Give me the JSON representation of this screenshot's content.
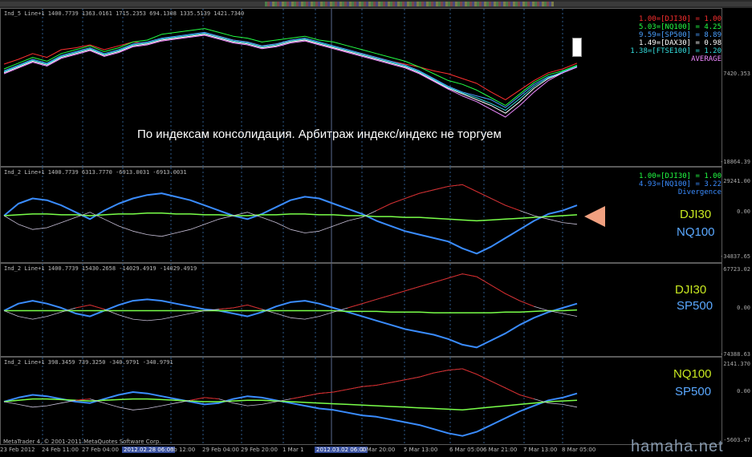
{
  "header_text": "",
  "annotation": "По индексам консолидация. Арбитраж индекс/индекс не торгуем",
  "copyright": "MetaTrader 4, © 2001-2011 MetaQuotes Software Corp.",
  "watermark": "hamaha.net",
  "colors": {
    "dji": "#ff3030",
    "nq": "#22ff44",
    "sp": "#4aa0ff",
    "dax": "#ffffff",
    "ftse": "#33dddd",
    "average": "#ee88ff",
    "divergence": "#3a8cff",
    "green_line": "#7aff4a",
    "white_line": "#c8c0d8",
    "red_line": "#dd2020",
    "pair_yellow": "#c8e820",
    "pair_blue": "#5aa8ff",
    "grid": "#2e5a8a"
  },
  "panels": [
    {
      "id": "main",
      "header": "Ind_5 Line+1 1400.7739 1363.0161 1715.2353 694.1308 1335.5139 1421.7340",
      "axis_top": "7420.353",
      "axis_bottom": "-18864.39",
      "legend": [
        {
          "text": "1.00=[DJI30] = 1.00",
          "color": "#ff3030"
        },
        {
          "text": "5.03=[NQ100] = 4.25",
          "color": "#22ff44"
        },
        {
          "text": "9.59=[SP500] = 8.89",
          "color": "#4aa0ff"
        },
        {
          "text": "1.49=[DAX30] = 0.98",
          "color": "#ffffff"
        },
        {
          "text": "1.38=[FTSE100] = 1.20",
          "color": "#33dddd"
        },
        {
          "text": "AVERAGE",
          "color": "#ee88ff"
        }
      ]
    },
    {
      "id": "div1",
      "header": "Ind_2 Line+1 1400.7739 6313.7770 -6913.0031 -6913.0031",
      "axis_top": "29241.00",
      "axis_mid": "0.00",
      "axis_bottom": "-34837.65",
      "legend": [
        {
          "text": "1.00=[DJI30] = 1.00",
          "color": "#22ff44"
        },
        {
          "text": "4.93=[NQ100] = 3.22",
          "color": "#3a8cff"
        },
        {
          "text": "Divergence",
          "color": "#3a8cff"
        }
      ],
      "pair_top": "DJI30",
      "pair_bottom": "NQ100"
    },
    {
      "id": "div2",
      "header": "Ind_2 Line+1 1400.7739 15430.2658 -14029.4919 -14029.4919",
      "axis_top": "67723.02",
      "axis_mid": "0.00",
      "axis_bottom": "-74388.63",
      "pair_top": "DJI30",
      "pair_bottom": "SP500"
    },
    {
      "id": "div3",
      "header": "Ind_2 Line+1 398.3459 739.3250 -340.9791 -340.9791",
      "axis_top": "2141.370",
      "axis_mid": "0.00",
      "axis_bottom": "-5603.47",
      "pair_top": "NQ100",
      "pair_bottom": "SP500"
    }
  ],
  "time_labels": [
    {
      "text": "23 Feb 2012",
      "hl": false
    },
    {
      "text": "24 Feb 11:00",
      "hl": false
    },
    {
      "text": "27 Feb 04:00",
      "hl": false
    },
    {
      "text": "2012.02.28 06:00",
      "hl": true
    },
    {
      "text": "eb 12:00",
      "hl": false
    },
    {
      "text": "29 Feb 04:00",
      "hl": false
    },
    {
      "text": "29 Feb 20:00",
      "hl": false
    },
    {
      "text": "1 Mar 1",
      "hl": false
    },
    {
      "text": "2012.03.02 06:00",
      "hl": true
    },
    {
      "text": "2 Mar 20:00",
      "hl": false
    },
    {
      "text": "5 Mar 13:00",
      "hl": false
    },
    {
      "text": "6 Mar 05:00",
      "hl": false
    },
    {
      "text": "6 Mar 21:00",
      "hl": false
    },
    {
      "text": "7 Mar 13:00",
      "hl": false
    },
    {
      "text": "8 Mar 05:00",
      "hl": false
    }
  ],
  "chart_data": [
    {
      "type": "line",
      "title": "",
      "x": [
        0,
        1,
        2,
        3,
        4,
        5,
        6,
        7,
        8,
        9,
        10,
        11,
        12,
        13,
        14,
        15,
        16,
        17,
        18,
        19,
        20,
        21,
        22,
        23,
        24,
        25,
        26,
        27,
        28,
        29,
        30,
        31,
        32,
        33,
        34,
        35,
        36,
        37,
        38,
        39,
        40
      ],
      "series": [
        {
          "name": "DJI30",
          "values": [
            55,
            60,
            66,
            62,
            70,
            72,
            75,
            70,
            74,
            78,
            76,
            80,
            82,
            84,
            86,
            84,
            80,
            78,
            74,
            76,
            79,
            80,
            76,
            72,
            68,
            66,
            62,
            58,
            55,
            52,
            48,
            45,
            40,
            35,
            26,
            18,
            28,
            38,
            46,
            50,
            56
          ]
        },
        {
          "name": "NQ100",
          "values": [
            50,
            56,
            62,
            58,
            66,
            70,
            74,
            68,
            72,
            78,
            80,
            86,
            88,
            90,
            92,
            88,
            84,
            82,
            78,
            80,
            82,
            84,
            80,
            78,
            74,
            70,
            66,
            62,
            58,
            52,
            45,
            38,
            34,
            28,
            20,
            12,
            24,
            36,
            44,
            48,
            54
          ]
        },
        {
          "name": "SP500",
          "values": [
            48,
            54,
            60,
            56,
            64,
            68,
            72,
            66,
            70,
            76,
            78,
            82,
            84,
            86,
            88,
            84,
            80,
            78,
            74,
            76,
            80,
            82,
            78,
            74,
            70,
            66,
            62,
            58,
            54,
            48,
            40,
            32,
            26,
            22,
            18,
            10,
            22,
            34,
            42,
            46,
            52
          ]
        },
        {
          "name": "DAX30",
          "values": [
            46,
            52,
            58,
            54,
            62,
            66,
            70,
            64,
            68,
            74,
            76,
            80,
            82,
            84,
            86,
            82,
            78,
            76,
            72,
            74,
            78,
            80,
            76,
            72,
            68,
            64,
            60,
            56,
            52,
            46,
            38,
            30,
            24,
            18,
            12,
            4,
            16,
            30,
            40,
            46,
            52
          ]
        },
        {
          "name": "FTSE100",
          "values": [
            47,
            53,
            59,
            55,
            63,
            67,
            71,
            65,
            69,
            75,
            77,
            81,
            83,
            85,
            87,
            83,
            79,
            77,
            73,
            75,
            79,
            81,
            77,
            73,
            69,
            65,
            61,
            57,
            53,
            47,
            39,
            31,
            25,
            20,
            14,
            7,
            19,
            32,
            41,
            47,
            53
          ]
        },
        {
          "name": "AVERAGE",
          "values": [
            45,
            51,
            57,
            53,
            61,
            65,
            69,
            63,
            67,
            73,
            75,
            79,
            81,
            83,
            85,
            81,
            77,
            75,
            71,
            73,
            77,
            79,
            75,
            71,
            67,
            63,
            59,
            55,
            51,
            45,
            37,
            29,
            22,
            16,
            8,
            0,
            12,
            26,
            38,
            46,
            52
          ]
        }
      ]
    },
    {
      "type": "line",
      "title": "",
      "x": [
        0,
        1,
        2,
        3,
        4,
        5,
        6,
        7,
        8,
        9,
        10,
        11,
        12,
        13,
        14,
        15,
        16,
        17,
        18,
        19,
        20,
        21,
        22,
        23,
        24,
        25,
        26,
        27,
        28,
        29,
        30,
        31,
        32,
        33,
        34,
        35,
        36,
        37,
        38,
        39,
        40
      ],
      "series": [
        {
          "name": "Divergence",
          "values": [
            0,
            14,
            20,
            18,
            12,
            4,
            -4,
            6,
            14,
            20,
            24,
            26,
            22,
            18,
            12,
            6,
            0,
            -4,
            2,
            10,
            18,
            22,
            20,
            14,
            8,
            2,
            -6,
            -12,
            -18,
            -22,
            -26,
            -30,
            -38,
            -44,
            -36,
            -26,
            -16,
            -6,
            2,
            6,
            12
          ]
        },
        {
          "name": "DJI30",
          "values": [
            0,
            1,
            2,
            2,
            1,
            1,
            0,
            1,
            2,
            2,
            3,
            3,
            2,
            2,
            1,
            1,
            0,
            0,
            1,
            1,
            2,
            2,
            1,
            1,
            0,
            0,
            -1,
            -1,
            -2,
            -2,
            -3,
            -4,
            -5,
            -6,
            -5,
            -4,
            -3,
            -2,
            -1,
            0,
            1
          ]
        },
        {
          "name": "NQ100",
          "values": [
            0,
            -10,
            -16,
            -14,
            -8,
            -2,
            4,
            -4,
            -12,
            -18,
            -22,
            -24,
            -20,
            -16,
            -10,
            -4,
            0,
            4,
            -2,
            -8,
            -16,
            -20,
            -18,
            -12,
            -6,
            -2,
            6,
            14,
            20,
            26,
            30,
            34,
            36,
            28,
            20,
            12,
            6,
            0,
            -4,
            -8,
            -10
          ]
        }
      ]
    },
    {
      "type": "line",
      "title": "",
      "x": [
        0,
        1,
        2,
        3,
        4,
        5,
        6,
        7,
        8,
        9,
        10,
        11,
        12,
        13,
        14,
        15,
        16,
        17,
        18,
        19,
        20,
        21,
        22,
        23,
        24,
        25,
        26,
        27,
        28,
        29,
        30,
        31,
        32,
        33,
        34,
        35,
        36,
        37,
        38,
        39,
        40
      ],
      "series": [
        {
          "name": "Divergence",
          "values": [
            0,
            10,
            14,
            10,
            4,
            -4,
            -8,
            0,
            8,
            14,
            16,
            14,
            10,
            6,
            2,
            0,
            -4,
            -8,
            -2,
            6,
            12,
            14,
            10,
            4,
            -2,
            -8,
            -14,
            -20,
            -26,
            -30,
            -34,
            -40,
            -48,
            -52,
            -42,
            -32,
            -20,
            -10,
            -2,
            4,
            10
          ]
        },
        {
          "name": "DJI30",
          "values": [
            0,
            0,
            0,
            0,
            0,
            0,
            0,
            0,
            0,
            0,
            0,
            0,
            0,
            0,
            0,
            0,
            0,
            0,
            0,
            0,
            0,
            0,
            0,
            0,
            -1,
            -1,
            -1,
            -2,
            -2,
            -2,
            -3,
            -3,
            -3,
            -3,
            -3,
            -2,
            -2,
            -1,
            0,
            0,
            1
          ]
        },
        {
          "name": "SP500",
          "values": [
            0,
            -8,
            -12,
            -8,
            -2,
            4,
            8,
            2,
            -6,
            -12,
            -14,
            -12,
            -8,
            -4,
            0,
            2,
            4,
            8,
            2,
            -4,
            -10,
            -12,
            -8,
            -2,
            4,
            10,
            16,
            22,
            28,
            34,
            40,
            46,
            52,
            48,
            36,
            24,
            14,
            6,
            0,
            -4,
            -8
          ]
        }
      ]
    },
    {
      "type": "line",
      "title": "",
      "x": [
        0,
        1,
        2,
        3,
        4,
        5,
        6,
        7,
        8,
        9,
        10,
        11,
        12,
        13,
        14,
        15,
        16,
        17,
        18,
        19,
        20,
        21,
        22,
        23,
        24,
        25,
        26,
        27,
        28,
        29,
        30,
        31,
        32,
        33,
        34,
        35,
        36,
        37,
        38,
        39,
        40
      ],
      "series": [
        {
          "name": "Divergence",
          "values": [
            0,
            6,
            10,
            8,
            4,
            0,
            -2,
            4,
            10,
            14,
            12,
            8,
            4,
            0,
            -4,
            -2,
            4,
            8,
            6,
            2,
            -2,
            -6,
            -10,
            -12,
            -16,
            -20,
            -22,
            -26,
            -30,
            -34,
            -40,
            -46,
            -50,
            -44,
            -34,
            -24,
            -14,
            -6,
            2,
            6,
            12
          ]
        },
        {
          "name": "NQ100",
          "values": [
            0,
            2,
            4,
            4,
            3,
            2,
            1,
            2,
            3,
            4,
            4,
            3,
            2,
            1,
            0,
            0,
            1,
            2,
            2,
            1,
            0,
            -1,
            -2,
            -3,
            -4,
            -5,
            -6,
            -7,
            -8,
            -9,
            -10,
            -11,
            -12,
            -10,
            -8,
            -6,
            -4,
            -2,
            0,
            1,
            2
          ]
        },
        {
          "name": "SP500",
          "values": [
            0,
            -4,
            -8,
            -6,
            -2,
            2,
            4,
            -2,
            -8,
            -12,
            -10,
            -6,
            -2,
            2,
            6,
            4,
            -2,
            -6,
            -4,
            0,
            4,
            8,
            12,
            14,
            18,
            22,
            24,
            28,
            32,
            36,
            42,
            46,
            48,
            40,
            30,
            20,
            10,
            4,
            -2,
            -4,
            -8
          ]
        }
      ]
    }
  ]
}
